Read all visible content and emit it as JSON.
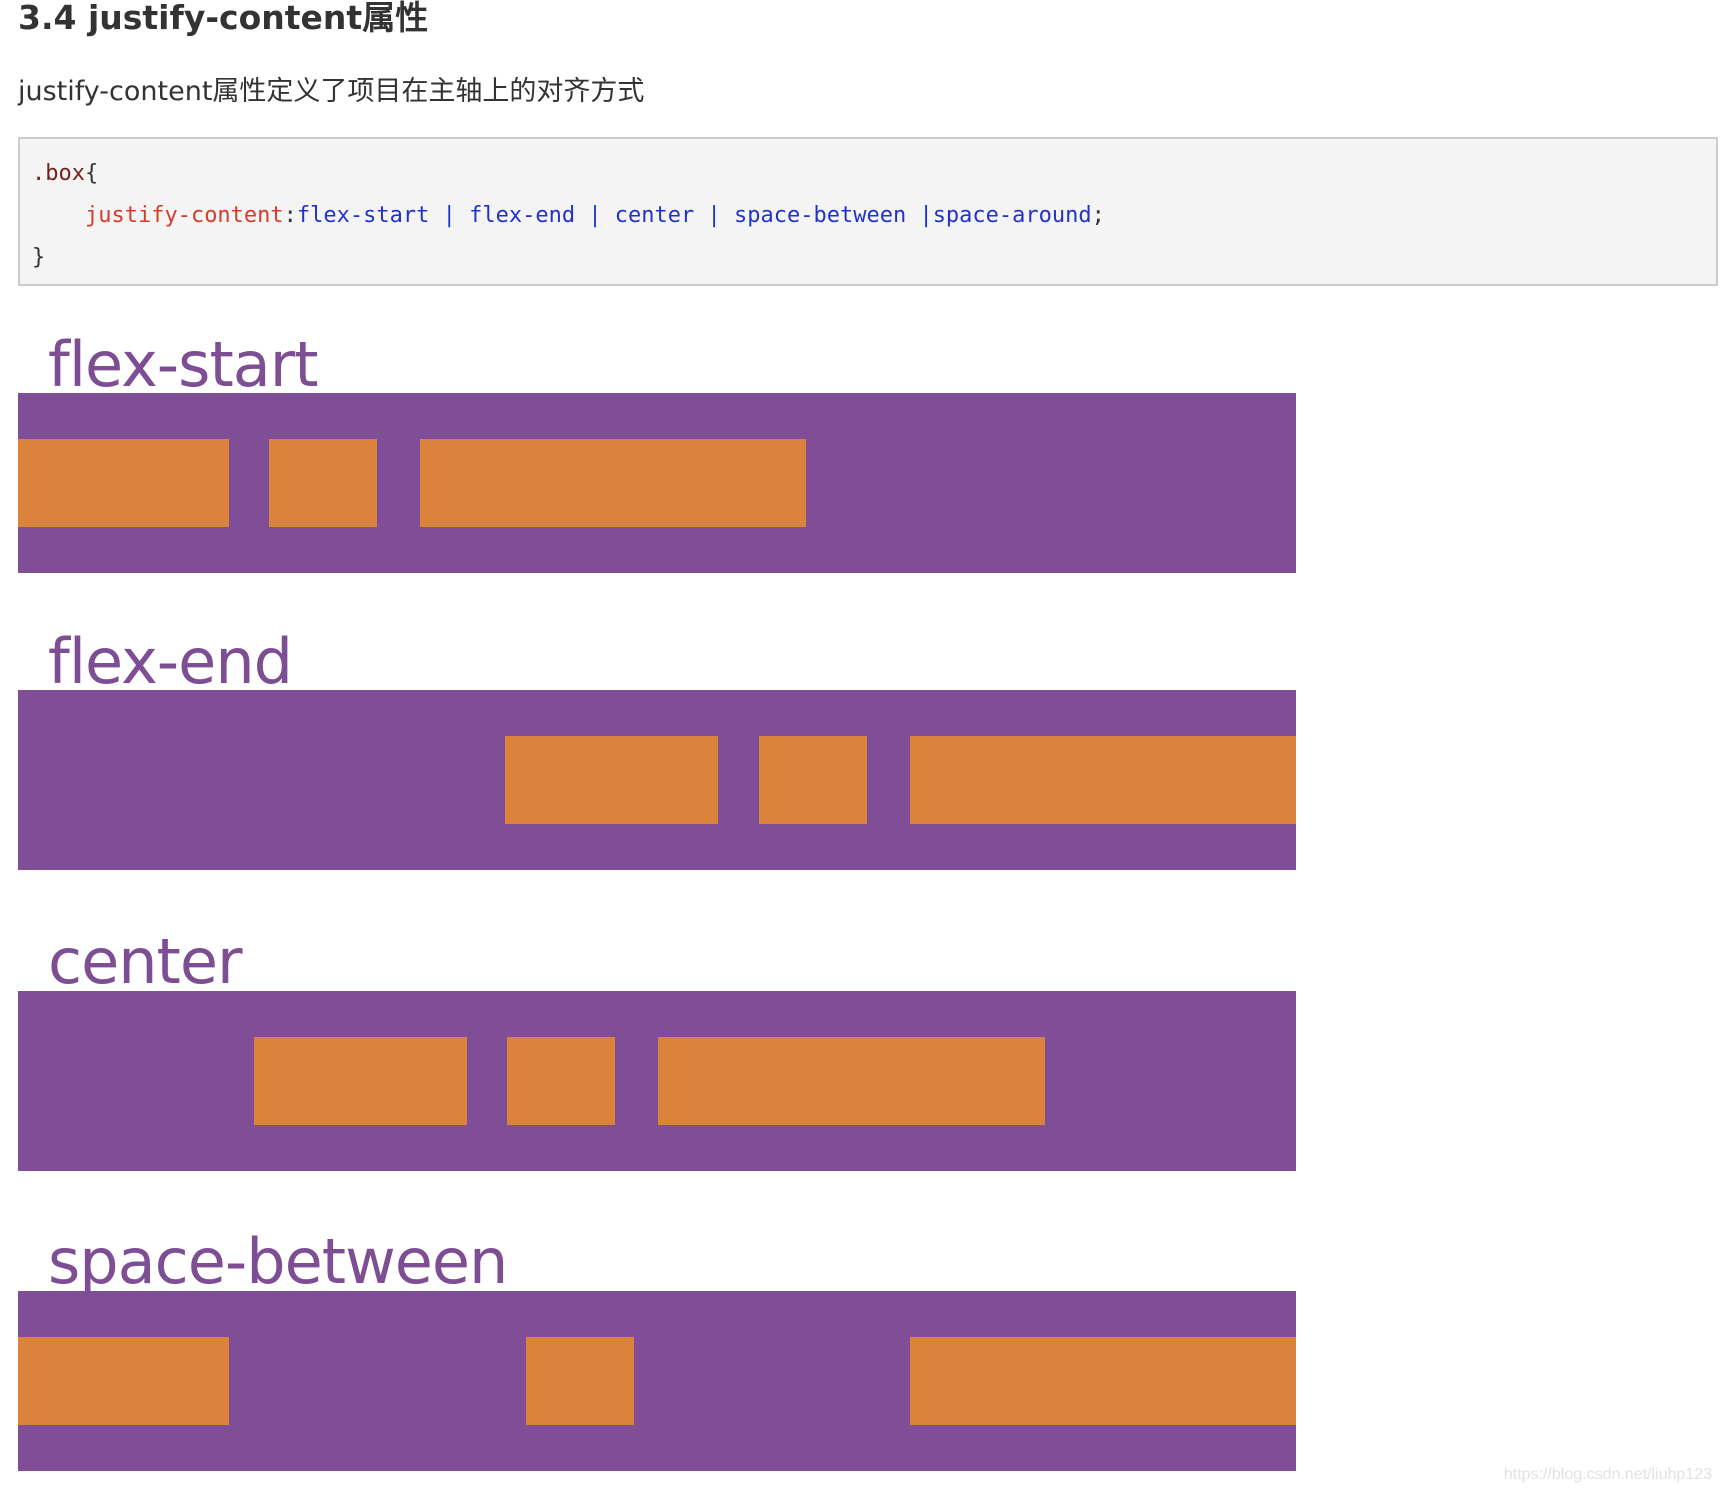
{
  "heading": "3.4 justify-content属性",
  "paragraph": "justify-content属性定义了项目在主轴上的对齐方式",
  "code": {
    "selector": ".box",
    "open_brace": "{",
    "indent": "    ",
    "property": "justify-content",
    "colon": ":",
    "value": "flex-start | flex-end | center | space-between |space-around",
    "semicolon": ";",
    "close_brace": "}"
  },
  "demos": [
    {
      "label": "flex-start"
    },
    {
      "label": "flex-end"
    },
    {
      "label": "center"
    },
    {
      "label": "space-between"
    }
  ],
  "colors": {
    "container": "#7f4e96",
    "item": "#db833b",
    "label": "#7e4e95"
  },
  "watermark": "https://blog.csdn.net/liuhp123"
}
